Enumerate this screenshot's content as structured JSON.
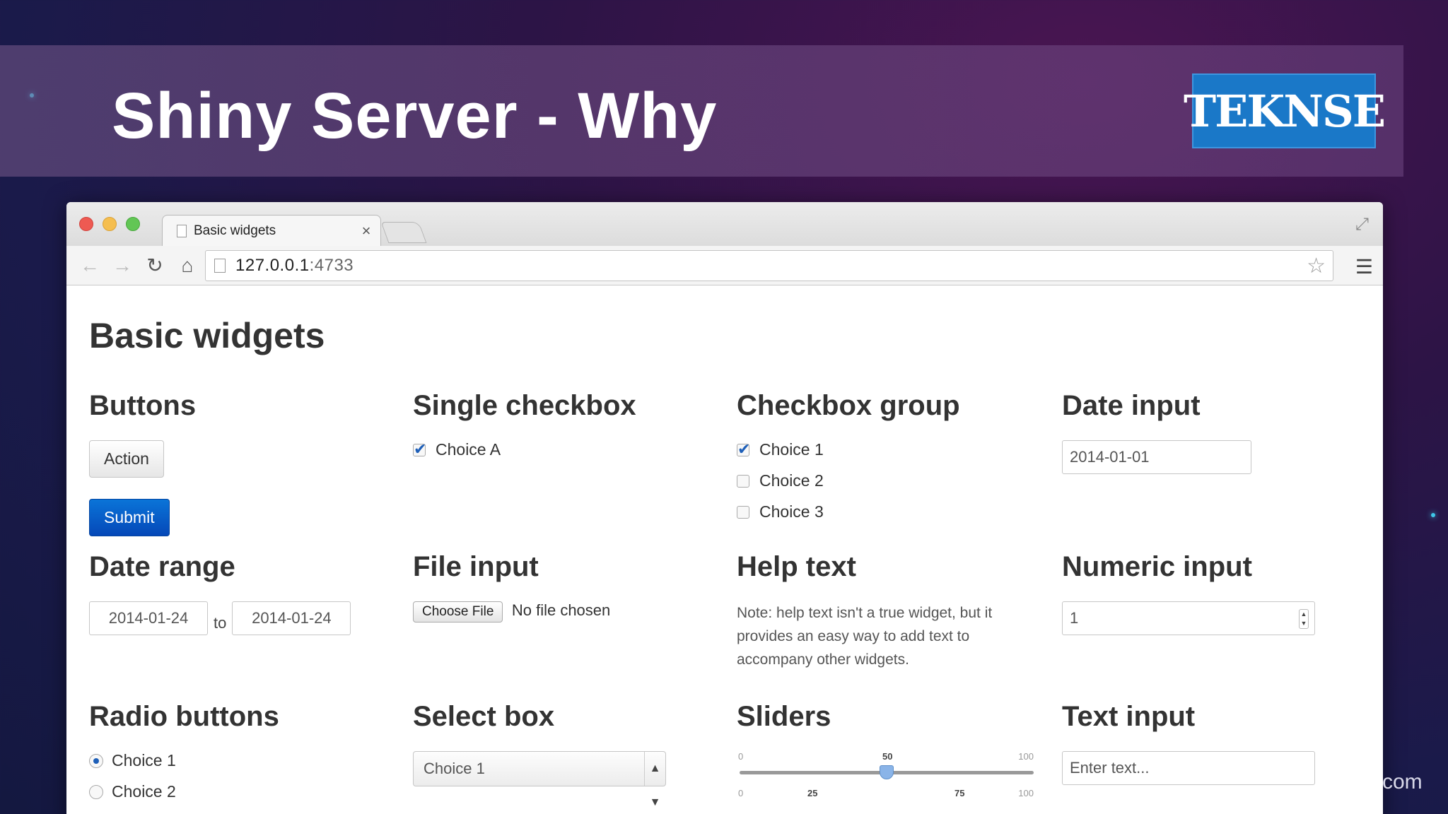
{
  "slide": {
    "title": "Shiny Server - Why",
    "logo_text": "TEKNSE",
    "footer_text": "com"
  },
  "browser": {
    "tab_label": "Basic widgets",
    "tab_close": "×",
    "url_host": "127.0.0.1",
    "url_port": ":4733"
  },
  "page": {
    "title": "Basic widgets",
    "buttons": {
      "heading": "Buttons",
      "action_label": "Action",
      "submit_label": "Submit"
    },
    "single_checkbox": {
      "heading": "Single checkbox",
      "label": "Choice A",
      "checked": true
    },
    "checkbox_group": {
      "heading": "Checkbox group",
      "items": [
        {
          "label": "Choice 1",
          "checked": true
        },
        {
          "label": "Choice 2",
          "checked": false
        },
        {
          "label": "Choice 3",
          "checked": false
        }
      ]
    },
    "date_input": {
      "heading": "Date input",
      "value": "2014-01-01"
    },
    "date_range": {
      "heading": "Date range",
      "start": "2014-01-24",
      "separator": "to",
      "end": "2014-01-24"
    },
    "file_input": {
      "heading": "File input",
      "button_label": "Choose File",
      "status": "No file chosen"
    },
    "help_text": {
      "heading": "Help text",
      "text": "Note: help text isn't a true widget, but it provides an easy way to add text to accompany other widgets."
    },
    "numeric_input": {
      "heading": "Numeric input",
      "value": "1"
    },
    "radio_buttons": {
      "heading": "Radio buttons",
      "items": [
        {
          "label": "Choice 1",
          "selected": true
        },
        {
          "label": "Choice 2",
          "selected": false
        }
      ]
    },
    "select_box": {
      "heading": "Select box",
      "selected": "Choice 1"
    },
    "sliders": {
      "heading": "Sliders",
      "slider1": {
        "min": "0",
        "max": "100",
        "value": "50",
        "fraction": 0.5
      },
      "slider2": {
        "min": "0",
        "max": "100",
        "low": "25",
        "high": "75",
        "low_fraction": 0.25,
        "high_fraction": 0.75
      }
    },
    "text_input": {
      "heading": "Text input",
      "placeholder": "Enter text..."
    }
  }
}
